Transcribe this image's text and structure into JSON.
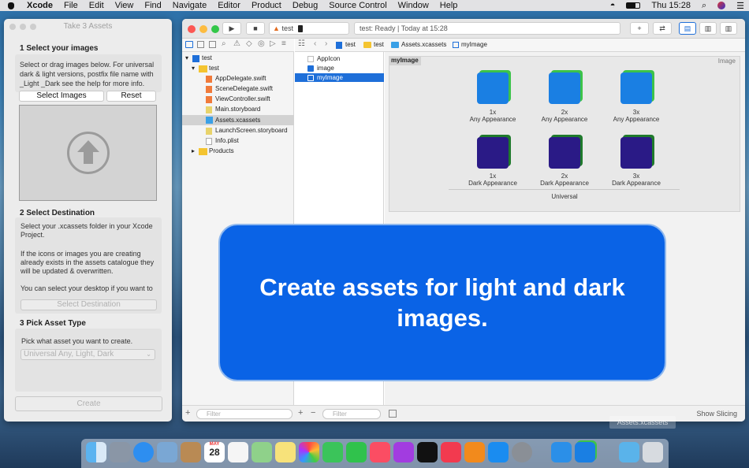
{
  "menubar": {
    "apple": "",
    "app": "Xcode",
    "items": [
      "File",
      "Edit",
      "View",
      "Find",
      "Navigate",
      "Editor",
      "Product",
      "Debug",
      "Source Control",
      "Window",
      "Help"
    ],
    "clock": "Thu 15:28"
  },
  "panel": {
    "title": "Take 3 Assets",
    "s1": {
      "heading": "1 Select your images",
      "text": "Select or drag images below. For universal dark & light versions, postfix file name with _Light _Dark see the help for more info.",
      "select": "Select Images",
      "reset": "Reset"
    },
    "s2": {
      "heading": "2 Select Destination",
      "p1": "Select your .xcassets folder in your Xcode Project.",
      "p2": "If the icons or images you are creating already exists in the assets catalogue they will be updated & overwritten.",
      "p3": "You can select your desktop if you want to",
      "button": "Select Destination"
    },
    "s3": {
      "heading": "3 Pick Asset Type",
      "text": "Pick what asset you want to create.",
      "select": "Universal Any, Light, Dark"
    },
    "create": "Create"
  },
  "xcode": {
    "scheme": "test",
    "status": "test: Ready | Today at 15:28",
    "breadcrumb": [
      "test",
      "test",
      "Assets.xcassets",
      "myImage"
    ],
    "navigator": {
      "root": "test",
      "group": "test",
      "files": [
        "AppDelegate.swift",
        "SceneDelegate.swift",
        "ViewController.swift",
        "Main.storyboard",
        "Assets.xcassets",
        "LaunchScreen.storyboard",
        "Info.plist"
      ],
      "products": "Products",
      "filter": "Filter"
    },
    "assets": {
      "items": [
        "AppIcon",
        "image",
        "myImage"
      ],
      "filter": "Filter"
    },
    "editor": {
      "set_name": "myImage",
      "kind": "Image",
      "group_label": "Universal",
      "show_slicing": "Show Slicing",
      "light": [
        {
          "scale": "1x",
          "label": "Any Appearance"
        },
        {
          "scale": "2x",
          "label": "Any Appearance"
        },
        {
          "scale": "3x",
          "label": "Any Appearance"
        }
      ],
      "dark": [
        {
          "scale": "1x",
          "label": "Dark Appearance"
        },
        {
          "scale": "2x",
          "label": "Dark Appearance"
        },
        {
          "scale": "3x",
          "label": "Dark Appearance"
        }
      ]
    }
  },
  "overlay": {
    "headline": "Create assets for light and dark images."
  },
  "desktop": {
    "ghost_label": "Assets.xcassets"
  },
  "dock": {
    "icons": [
      "finder-icon",
      "launchpad-icon",
      "safari-icon",
      "preview-icon",
      "contacts-icon",
      "calendar-icon",
      "reminders-icon",
      "maps-icon",
      "notes-icon",
      "photos-icon",
      "messages-icon",
      "facetime-icon",
      "music-icon",
      "podcasts-icon",
      "tv-icon",
      "news-icon",
      "books-icon",
      "app-store-icon",
      "system-preferences-icon",
      "xcode-icon",
      "take3assets-icon",
      "folder-icon",
      "trash-icon"
    ],
    "calendar_day": "28",
    "calendar_month": "MAY"
  },
  "colors": {
    "overlay": "#0a63e6",
    "light_tile": "#1a7fe3",
    "dark_tile": "#2a1a86",
    "accent": "#1e6fd9"
  }
}
